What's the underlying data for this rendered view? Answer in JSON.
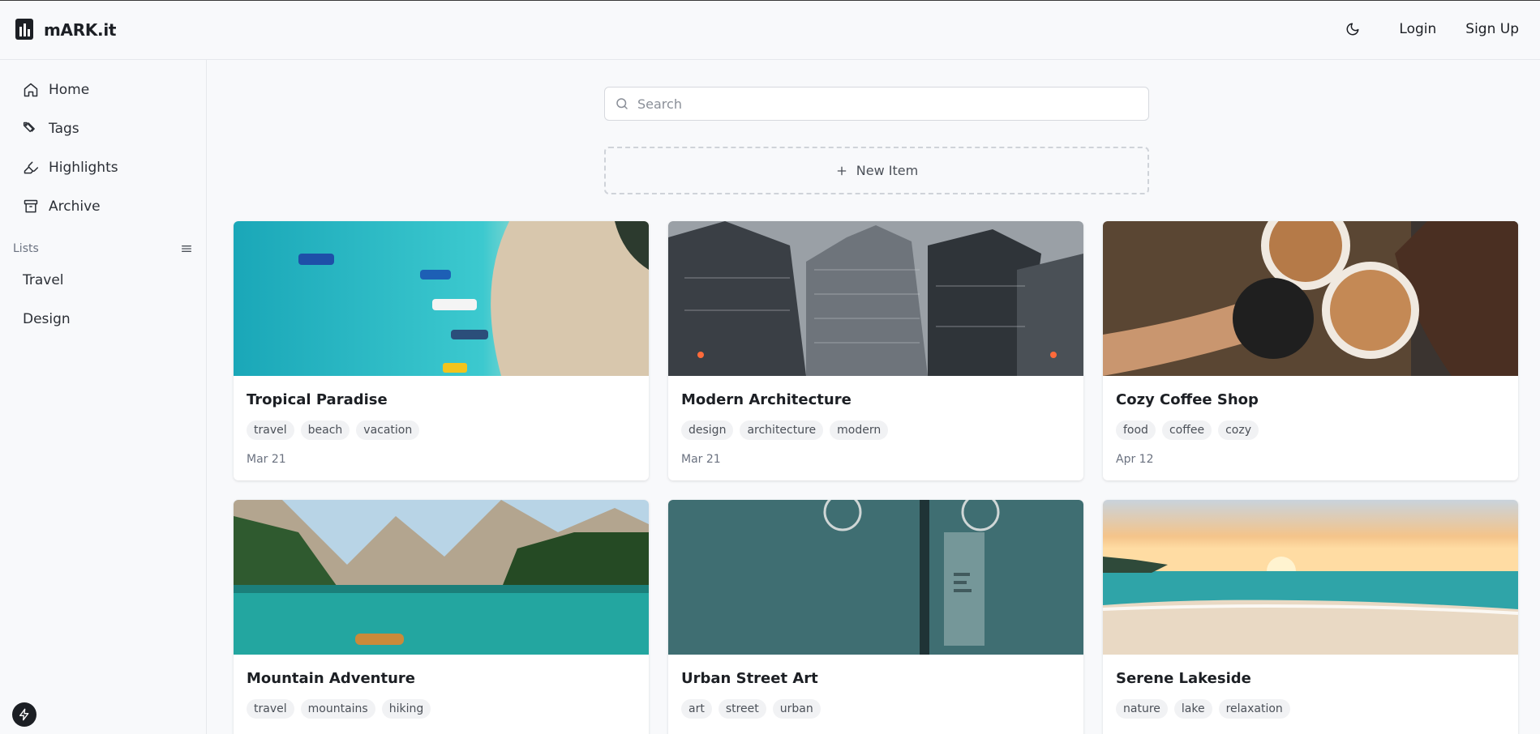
{
  "app": {
    "name": "mARK.it"
  },
  "header": {
    "login_label": "Login",
    "signup_label": "Sign Up",
    "theme_icon": "moon-icon"
  },
  "sidebar": {
    "items": [
      {
        "label": "Home",
        "icon": "home-icon"
      },
      {
        "label": "Tags",
        "icon": "tags-icon"
      },
      {
        "label": "Highlights",
        "icon": "highlighter-icon"
      },
      {
        "label": "Archive",
        "icon": "archive-icon"
      }
    ],
    "lists_title": "Lists",
    "lists": [
      {
        "label": "Travel"
      },
      {
        "label": "Design"
      }
    ]
  },
  "search": {
    "placeholder": "Search",
    "value": ""
  },
  "new_item": {
    "label": "New Item"
  },
  "cards": [
    {
      "title": "Tropical Paradise",
      "tags": [
        "travel",
        "beach",
        "vacation"
      ],
      "date": "Mar 21"
    },
    {
      "title": "Modern Architecture",
      "tags": [
        "design",
        "architecture",
        "modern"
      ],
      "date": "Mar 21"
    },
    {
      "title": "Cozy Coffee Shop",
      "tags": [
        "food",
        "coffee",
        "cozy"
      ],
      "date": "Apr 12"
    },
    {
      "title": "Mountain Adventure",
      "tags": [
        "travel",
        "mountains",
        "hiking"
      ],
      "date": ""
    },
    {
      "title": "Urban Street Art",
      "tags": [
        "art",
        "street",
        "urban"
      ],
      "date": ""
    },
    {
      "title": "Serene Lakeside",
      "tags": [
        "nature",
        "lake",
        "relaxation"
      ],
      "date": ""
    }
  ],
  "colors": {
    "background": "#f8f9fb",
    "text": "#1c1f24",
    "tag_bg": "#f1f2f4",
    "border": "#e6e8ec"
  }
}
